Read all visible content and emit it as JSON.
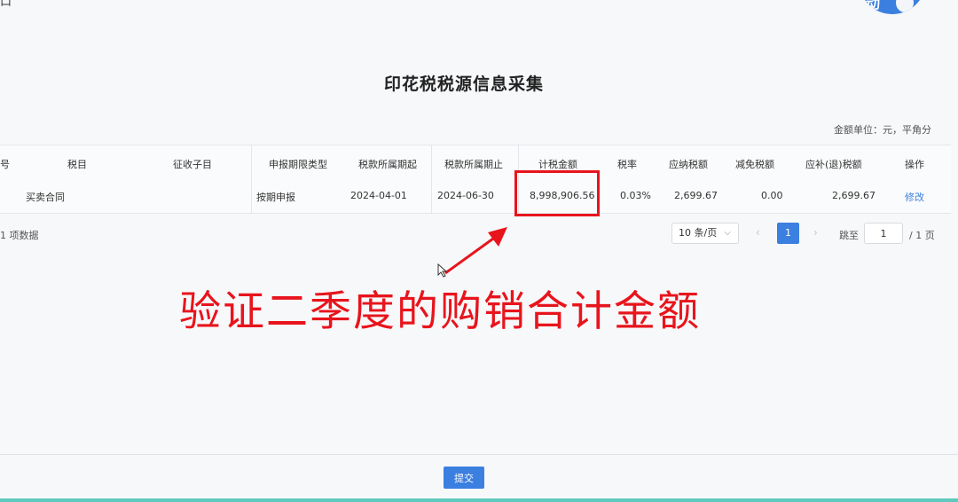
{
  "topbar": {
    "crumb": "口",
    "crumb_link": "——"
  },
  "avatar": {
    "bubble_text": "动"
  },
  "page_title": "印花税税源信息采集",
  "unit_note": "金额单位：元，平角分",
  "table": {
    "headers": [
      "号",
      "税目",
      "征收子目",
      "申报期限类型",
      "税款所属期起",
      "税款所属期止",
      "计税金额",
      "税率",
      "应纳税额",
      "减免税额",
      "应补(退)税额",
      "操作"
    ],
    "row": {
      "item": "买卖合同",
      "sub_item": "",
      "period_type": "按期申报",
      "period_start": "2024-04-01",
      "period_end": "2024-06-30",
      "taxable_amount": "8,998,906.56",
      "tax_rate": "0.03%",
      "tax_payable": "2,699.67",
      "tax_relief": "0.00",
      "tax_due": "2,699.67",
      "action": "修改"
    }
  },
  "pagination": {
    "total_text": "1 项数据",
    "page_size": "10 条/页",
    "current_page": "1",
    "jump_label": "跳至",
    "jump_value": "1",
    "total_pages": "/ 1 页"
  },
  "annotation": {
    "text": "验证二季度的购销合计金额",
    "color": "#e8141c"
  },
  "footer": {
    "submit_label": "提交"
  },
  "colors": {
    "accent": "#3b7fe0",
    "annotation_red": "#e8141c",
    "bottom_strip": "#5ec9bd"
  }
}
